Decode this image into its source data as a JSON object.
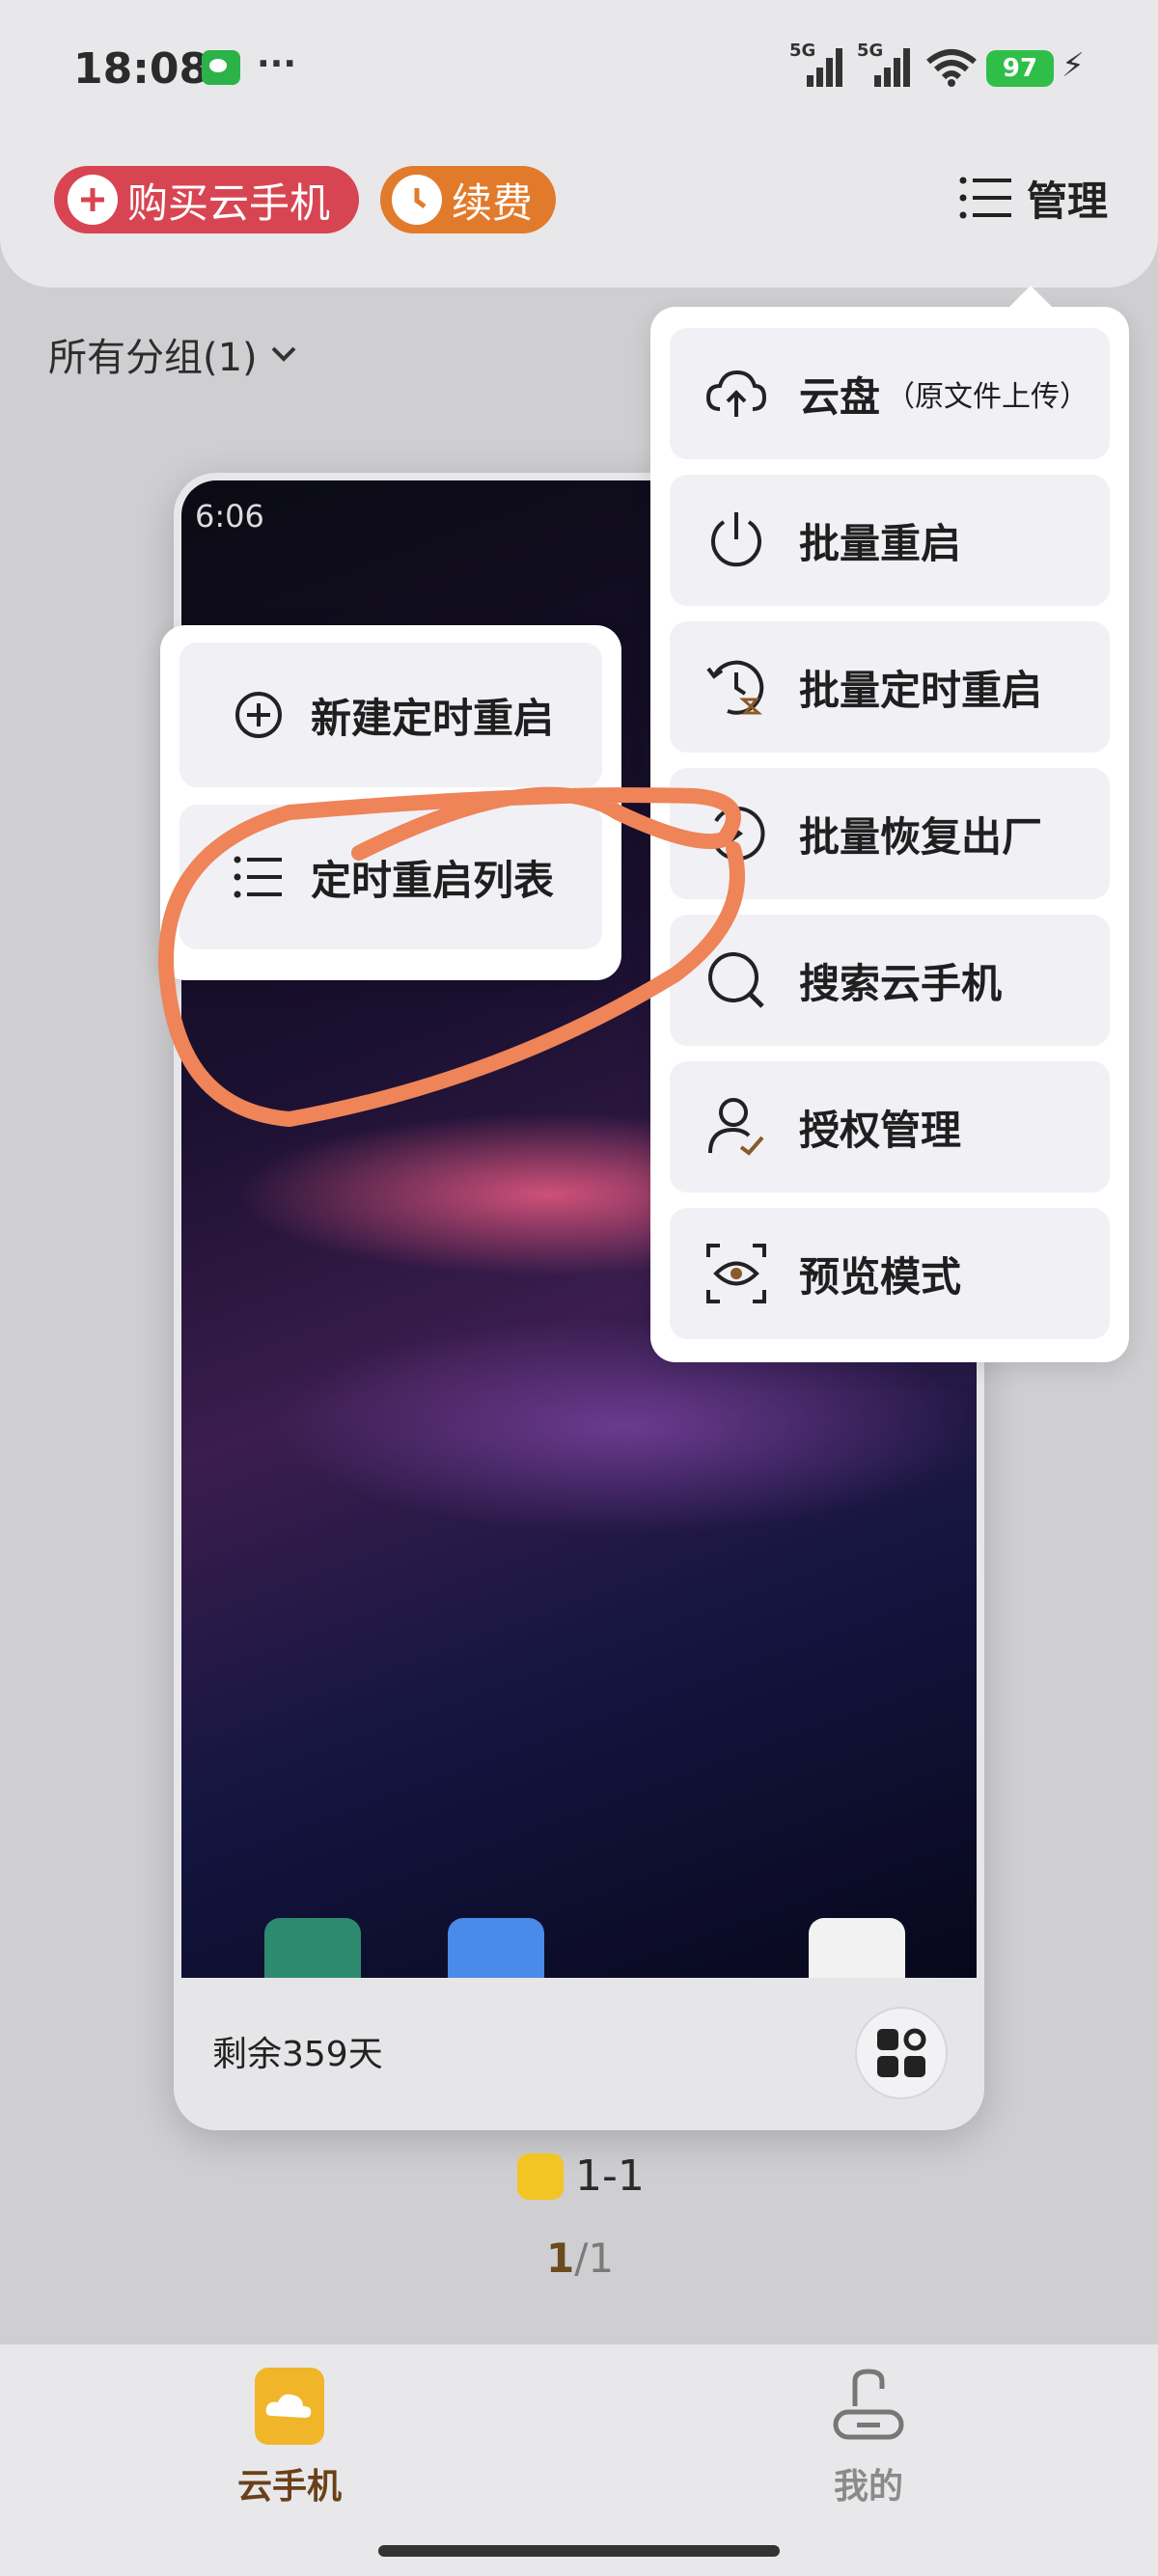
{
  "status_bar": {
    "time": "18:08",
    "network1": "5G",
    "network2": "5G",
    "battery": "97"
  },
  "header": {
    "buy_label": "购买云手机",
    "renew_label": "续费",
    "manage_label": "管理"
  },
  "group": {
    "label": "所有分组(1)"
  },
  "device": {
    "screen_time": "6:06",
    "remaining": "剩余359天",
    "name": "1-1",
    "page_current": "1",
    "page_total": "/1"
  },
  "manage_menu": {
    "items": [
      {
        "label": "云盘",
        "sub": "（原文件上传）",
        "icon": "cloud-upload-icon"
      },
      {
        "label": "批量重启",
        "icon": "power-icon"
      },
      {
        "label": "批量定时重启",
        "icon": "timer-restart-icon"
      },
      {
        "label": "批量恢复出厂",
        "icon": "factory-reset-icon"
      },
      {
        "label": "搜索云手机",
        "icon": "search-icon"
      },
      {
        "label": "授权管理",
        "icon": "user-check-icon"
      },
      {
        "label": "预览模式",
        "icon": "eye-scan-icon"
      }
    ]
  },
  "timer_submenu": {
    "items": [
      {
        "label": "新建定时重启",
        "icon": "plus-circle-icon"
      },
      {
        "label": "定时重启列表",
        "icon": "list-icon"
      }
    ]
  },
  "bottom_nav": {
    "items": [
      {
        "label": "云手机",
        "icon": "cloud-phone-icon",
        "active": true
      },
      {
        "label": "我的",
        "icon": "profile-icon",
        "active": false
      }
    ]
  },
  "colors": {
    "buy": "#d84552",
    "renew": "#e27a2b",
    "accent_brown": "#6b4019",
    "scribble": "#ee8458",
    "battery": "#2fbf48"
  }
}
